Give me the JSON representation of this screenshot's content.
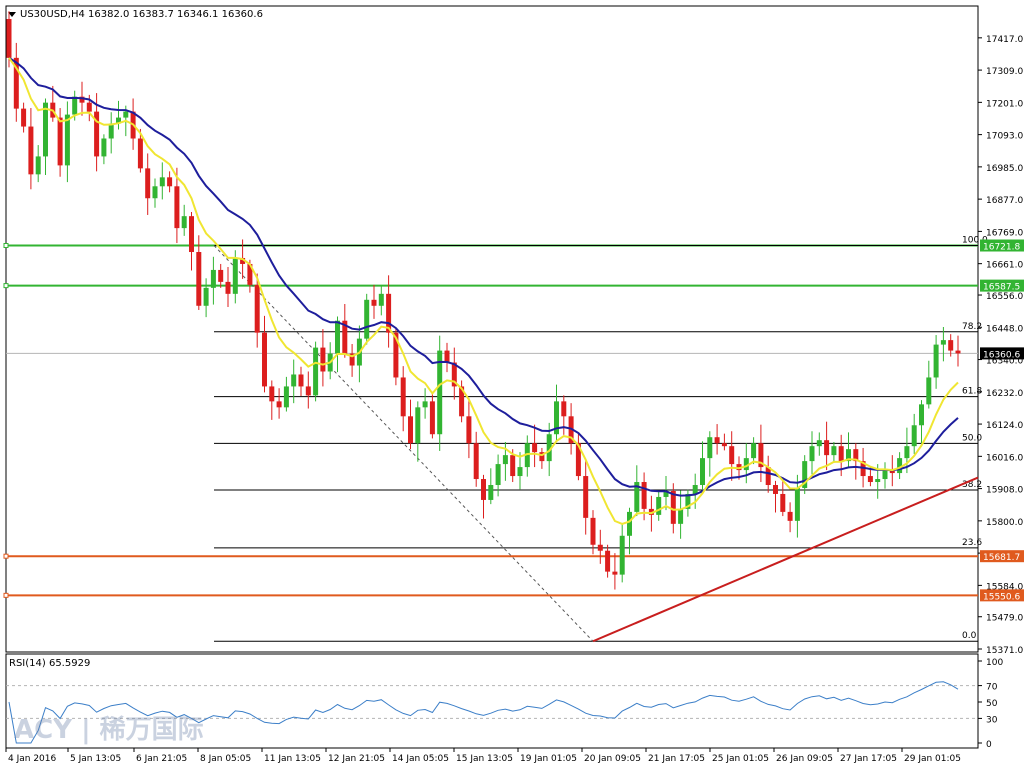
{
  "chart_data": [
    {
      "type": "candlestick",
      "title": "US30USD,H4  16382.0 16383.7 16346.1 16360.6",
      "symbol": "US30USD",
      "timeframe": "H4",
      "ohlc_header": "16382.0 16383.7 16346.1 16360.6",
      "ylim": [
        15371,
        17470
      ],
      "y_ticks": [
        "17417.0",
        "17309.0",
        "17201.0",
        "17093.0",
        "16985.0",
        "16877.0",
        "16769.0",
        "16661.0",
        "16556.0",
        "16448.0",
        "16340.0",
        "16232.0",
        "16124.0",
        "16016.0",
        "15908.0",
        "15800.0",
        "15692.0",
        "15584.0",
        "15479.0",
        "15371.0"
      ],
      "x_labels": [
        "4 Jan 2016",
        "5 Jan 13:05",
        "6 Jan 21:05",
        "8 Jan 05:05",
        "11 Jan 13:05",
        "12 Jan 21:05",
        "14 Jan 05:05",
        "15 Jan 13:05",
        "19 Jan 01:05",
        "20 Jan 09:05",
        "21 Jan 17:05",
        "25 Jan 01:05",
        "26 Jan 09:05",
        "27 Jan 17:05",
        "29 Jan 01:05"
      ],
      "current_price": "16360.6",
      "up_color": "#32b432",
      "down_color": "#dc1e1e",
      "candle_closes": [
        17350,
        17180,
        17120,
        16960,
        17020,
        17200,
        17150,
        16990,
        17160,
        17220,
        17200,
        17170,
        17020,
        17080,
        17130,
        17150,
        17170,
        17080,
        16980,
        16880,
        16920,
        16950,
        16920,
        16780,
        16820,
        16700,
        16520,
        16580,
        16640,
        16600,
        16560,
        16680,
        16660,
        16590,
        16430,
        16250,
        16200,
        16180,
        16250,
        16290,
        16250,
        16220,
        16380,
        16300,
        16360,
        16470,
        16360,
        16320,
        16410,
        16540,
        16520,
        16560,
        16430,
        16280,
        16150,
        16060,
        16180,
        16200,
        16090,
        16370,
        16330,
        16250,
        16150,
        16060,
        15940,
        15870,
        15920,
        15990,
        16020,
        15950,
        15980,
        16060,
        16030,
        16000,
        16090,
        16200,
        16150,
        16060,
        15950,
        15810,
        15720,
        15700,
        15630,
        15620,
        15750,
        15830,
        15930,
        15840,
        15820,
        15880,
        15900,
        15790,
        15840,
        15890,
        15920,
        16010,
        16080,
        16060,
        16050,
        15990,
        15970,
        16010,
        16060,
        15980,
        15920,
        15890,
        15830,
        15800,
        15910,
        16000,
        16050,
        16070,
        16020,
        16050,
        16000,
        16040,
        16000,
        15950,
        15930,
        15940,
        15970,
        15960,
        16010,
        16050,
        16120,
        16190,
        16280,
        16390,
        16405,
        16370,
        16360.6
      ]
    },
    {
      "type": "line",
      "title": "RSI(14) 65.5929",
      "ylim": [
        0,
        100
      ],
      "y_ticks": [
        "100",
        "70",
        "50",
        "30",
        "0"
      ],
      "levels": [
        70,
        30
      ],
      "line_color": "#3c7fc8"
    }
  ],
  "fib_levels": [
    "100.0",
    "78.2",
    "61.8",
    "50.0",
    "38.2",
    "23.6",
    "0.0"
  ],
  "horizontal_levels": [
    {
      "value": "16721.8",
      "color": "#32b432"
    },
    {
      "value": "16587.5",
      "color": "#32b432"
    },
    {
      "value": "15681.7",
      "color": "#e05a1e"
    },
    {
      "value": "15550.6",
      "color": "#e05a1e"
    }
  ],
  "indicators": {
    "ma_fast_color": "#f0e632",
    "ma_slow_color": "#1e1e9c",
    "trendline_color": "#c81e1e"
  },
  "watermark": "ACY | 稀万国际"
}
